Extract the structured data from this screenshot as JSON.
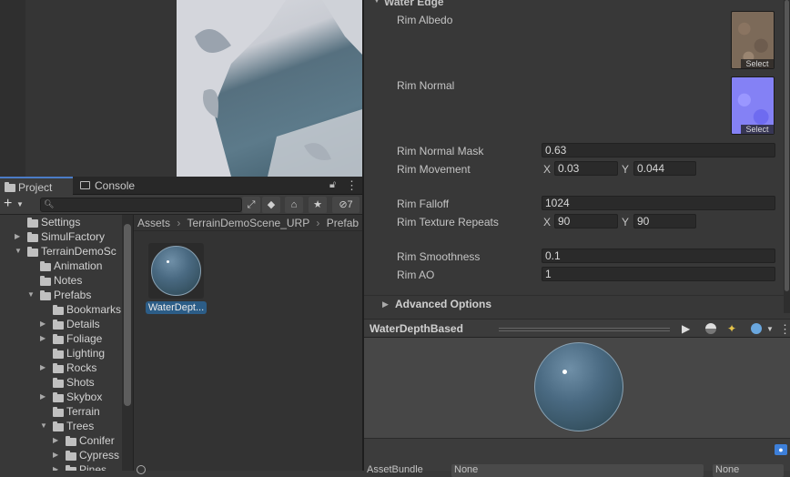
{
  "colors": {
    "accent": "#4b7cc7",
    "selection": "#2c5d87",
    "panel": "#383838"
  },
  "scene_view": {
    "description_icon": "scene-preview"
  },
  "project_panel": {
    "tabs": [
      {
        "label": "Project",
        "icon": "folder-icon"
      },
      {
        "label": "Console",
        "icon": "console-icon"
      }
    ],
    "hidden_count": "7",
    "tree": [
      {
        "label": "Settings",
        "indent": 0,
        "arrow": ""
      },
      {
        "label": "SimulFactory",
        "indent": 0,
        "arrow": "▶"
      },
      {
        "label": "TerrainDemoSc",
        "indent": 0,
        "arrow": "▼"
      },
      {
        "label": "Animation",
        "indent": 1,
        "arrow": ""
      },
      {
        "label": "Notes",
        "indent": 1,
        "arrow": ""
      },
      {
        "label": "Prefabs",
        "indent": 1,
        "arrow": "▼"
      },
      {
        "label": "Bookmarks",
        "indent": 2,
        "arrow": ""
      },
      {
        "label": "Details",
        "indent": 2,
        "arrow": "▶"
      },
      {
        "label": "Foliage",
        "indent": 2,
        "arrow": "▶"
      },
      {
        "label": "Lighting",
        "indent": 2,
        "arrow": ""
      },
      {
        "label": "Rocks",
        "indent": 2,
        "arrow": "▶"
      },
      {
        "label": "Shots",
        "indent": 2,
        "arrow": ""
      },
      {
        "label": "Skybox",
        "indent": 2,
        "arrow": "▶"
      },
      {
        "label": "Terrain",
        "indent": 2,
        "arrow": ""
      },
      {
        "label": "Trees",
        "indent": 2,
        "arrow": "▼"
      },
      {
        "label": "Conifer",
        "indent": 3,
        "arrow": "▶"
      },
      {
        "label": "Cypress",
        "indent": 3,
        "arrow": "▶"
      },
      {
        "label": "Pines",
        "indent": 3,
        "arrow": "▶"
      }
    ],
    "breadcrumb": [
      "Assets",
      "TerrainDemoScene_URP",
      "Prefab"
    ],
    "asset_label": "WaterDept..."
  },
  "inspector": {
    "section": "Water Edge",
    "rim_albedo": "Rim Albedo",
    "rim_normal": "Rim Normal",
    "select_label": "Select",
    "rim_normal_mask": {
      "label": "Rim Normal Mask",
      "value": "0.63"
    },
    "rim_movement": {
      "label": "Rim Movement",
      "x_label": "X",
      "x": "0.03",
      "y_label": "Y",
      "y": "0.044"
    },
    "rim_falloff": {
      "label": "Rim Falloff",
      "value": "1024"
    },
    "rim_texture_repeats": {
      "label": "Rim Texture Repeats",
      "x_label": "X",
      "x": "90",
      "y_label": "Y",
      "y": "90"
    },
    "rim_smoothness": {
      "label": "Rim Smoothness",
      "value": "0.1"
    },
    "rim_ao": {
      "label": "Rim AO",
      "value": "1"
    },
    "advanced": "Advanced Options"
  },
  "preview": {
    "title": "WaterDepthBased"
  },
  "asset_bundle": {
    "label": "AssetBundle",
    "value": "None",
    "variant": "None"
  }
}
